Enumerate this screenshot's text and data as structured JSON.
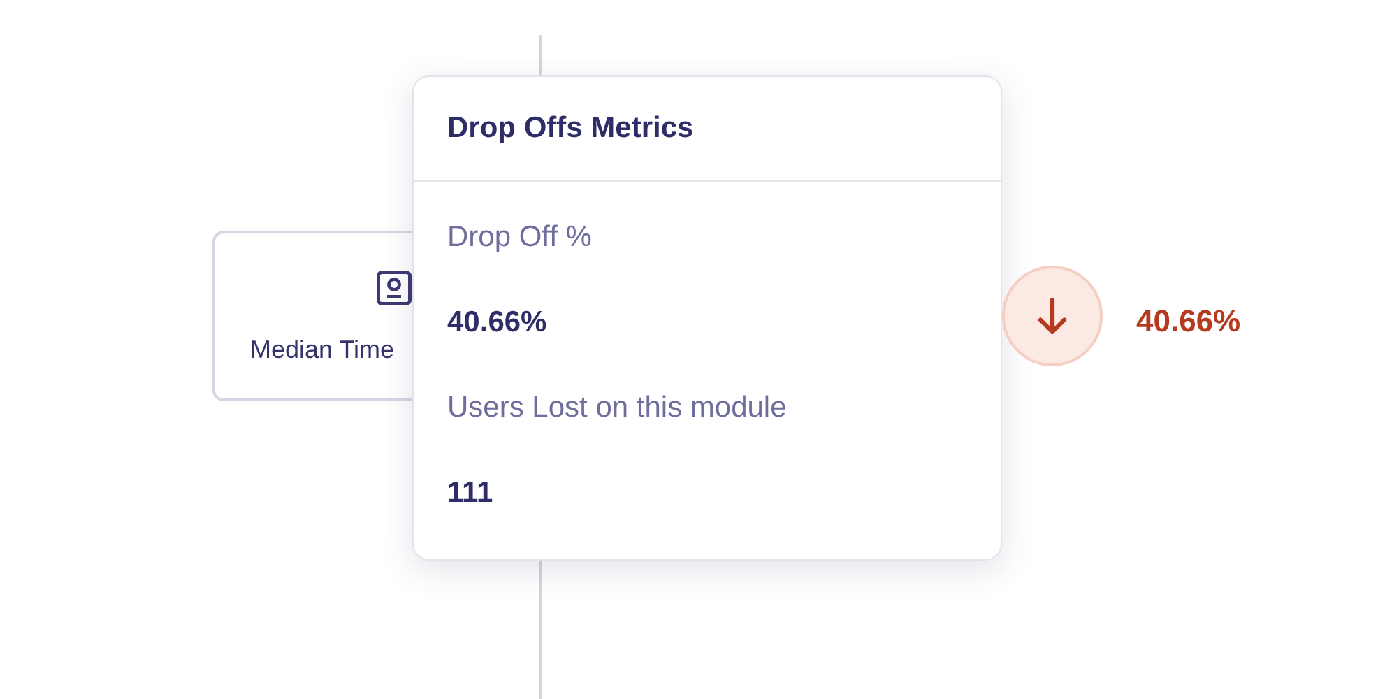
{
  "node": {
    "label": "Median Time"
  },
  "popup": {
    "title": "Drop Offs Metrics",
    "metrics": [
      {
        "label": "Drop Off %",
        "value": "40.66%"
      },
      {
        "label": "Users Lost on this module",
        "value": "111"
      }
    ]
  },
  "drop_off": {
    "value": "40.66%"
  }
}
